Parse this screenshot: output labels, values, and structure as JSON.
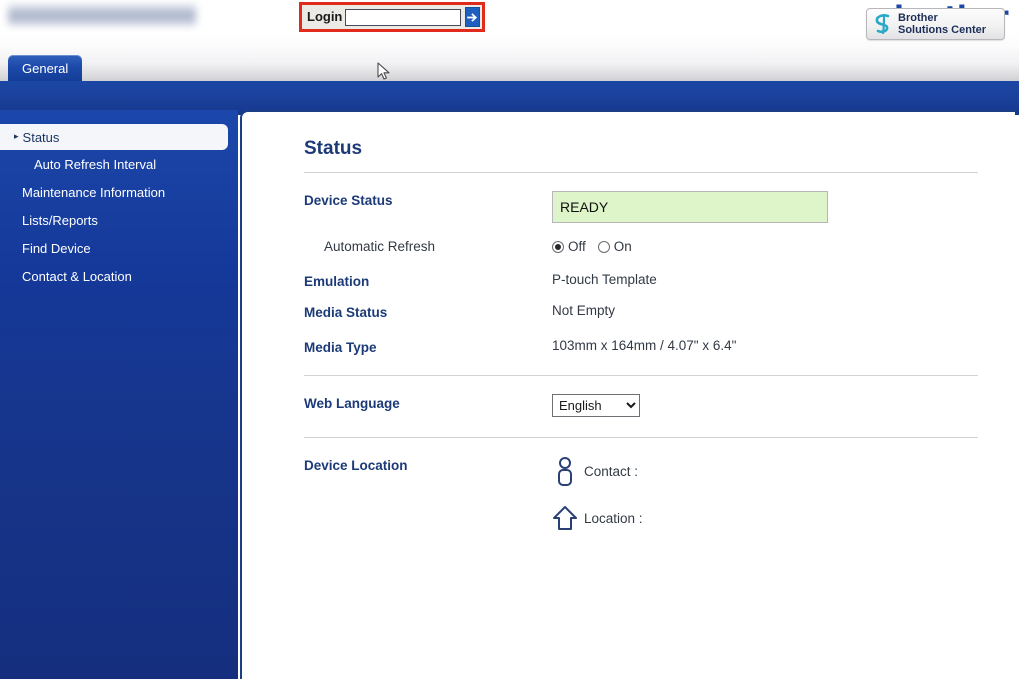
{
  "header": {
    "model_name_redacted": "",
    "login": {
      "label": "Login",
      "value": "",
      "placeholder": "",
      "submit_icon": "arrow-right-icon"
    },
    "brand_logo_text": "brother",
    "solutions_center": {
      "line1": "Brother",
      "line2": "Solutions Center",
      "icon": "brother-swirl-icon"
    }
  },
  "tabs": [
    {
      "label": "General",
      "active": true
    }
  ],
  "sidebar": {
    "items": [
      {
        "label": "Status",
        "active": true,
        "sub": false,
        "caret": "▸"
      },
      {
        "label": "Auto Refresh Interval",
        "active": false,
        "sub": true
      },
      {
        "label": "Maintenance Information",
        "active": false,
        "sub": false
      },
      {
        "label": "Lists/Reports",
        "active": false,
        "sub": false
      },
      {
        "label": "Find Device",
        "active": false,
        "sub": false
      },
      {
        "label": "Contact & Location",
        "active": false,
        "sub": false
      }
    ]
  },
  "main": {
    "title": "Status",
    "device_status": {
      "label": "Device Status",
      "value": "READY"
    },
    "automatic_refresh": {
      "label": "Automatic Refresh",
      "options": [
        {
          "label": "Off",
          "selected": true
        },
        {
          "label": "On",
          "selected": false
        }
      ]
    },
    "emulation": {
      "label": "Emulation",
      "value": "P-touch Template"
    },
    "media_status": {
      "label": "Media Status",
      "value": "Not Empty"
    },
    "media_type": {
      "label": "Media Type",
      "value": "103mm x 164mm / 4.07\" x 6.4\""
    },
    "web_language": {
      "label": "Web Language",
      "value": "English",
      "options": [
        "English"
      ]
    },
    "device_location": {
      "label": "Device Location",
      "contact": {
        "icon": "person-icon",
        "label": "Contact :",
        "value": ""
      },
      "location": {
        "icon": "home-icon",
        "label": "Location :",
        "value": ""
      }
    }
  },
  "colors": {
    "brand_blue": "#1d47a5",
    "nav_blue": "#15378c",
    "title_navy": "#1c3a78",
    "status_green": "#ddf5c9",
    "highlight_red": "#e02b1c"
  }
}
